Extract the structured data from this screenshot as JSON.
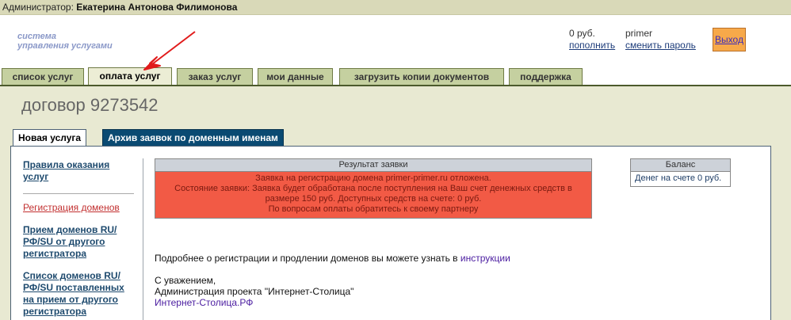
{
  "admin_bar": {
    "prefix": "Администратор:",
    "name": "Екатерина Антонова Филимонова"
  },
  "logo": {
    "line1": "система",
    "line2": "управления услугами"
  },
  "account": {
    "balance": "0 руб.",
    "topup": "пополнить",
    "login": "primer",
    "change_password": "сменить пароль",
    "exit": "Выход"
  },
  "tabs": [
    {
      "label": "список услуг"
    },
    {
      "label": "оплата услуг"
    },
    {
      "label": "заказ услуг"
    },
    {
      "label": "мои данные"
    },
    {
      "label": "загрузить копии документов"
    },
    {
      "label": "поддержка"
    }
  ],
  "contract_title": "договор 9273542",
  "subtabs": [
    {
      "label": "Новая услуга"
    },
    {
      "label": "Архив заявок по доменным именам"
    }
  ],
  "sidenav": [
    {
      "label": "Правила оказания услуг"
    },
    {
      "label": "Регистрация доменов"
    },
    {
      "label": "Прием доменов RU/РФ/SU от другого регистратора"
    },
    {
      "label": "Список доменов RU/РФ/SU поставленных на прием от другого регистратора"
    }
  ],
  "result": {
    "header": "Результат заявки",
    "line1": "Заявка на регистрацию домена primer-primer.ru отложена.",
    "line2": "Состояние заявки: Заявка будет обработана после поступления на Ваш счет денежных средств в",
    "line3": "размере 150 руб. Доступных средств на счете: 0 руб.",
    "line4": "По вопросам оплаты обратитесь к своему партнеру"
  },
  "balance": {
    "header": "Баланс",
    "label": "Денег на счете",
    "value": "0 руб."
  },
  "info": {
    "text": "Подробнее о регистрации и продлении доменов вы можете узнать в",
    "link": "инструкции"
  },
  "signature": {
    "greeting": "С уважением,",
    "admin": "Администрация проекта \"Интернет-Столица\"",
    "site": "Интернет-Столица.РФ"
  },
  "colors": {
    "accent_tab": "#c5d0a0",
    "error_bg": "#f25a45",
    "exit_button": "#f7a94a",
    "subtab_dark": "#0a4a72",
    "arrow": "#e11b1b"
  }
}
